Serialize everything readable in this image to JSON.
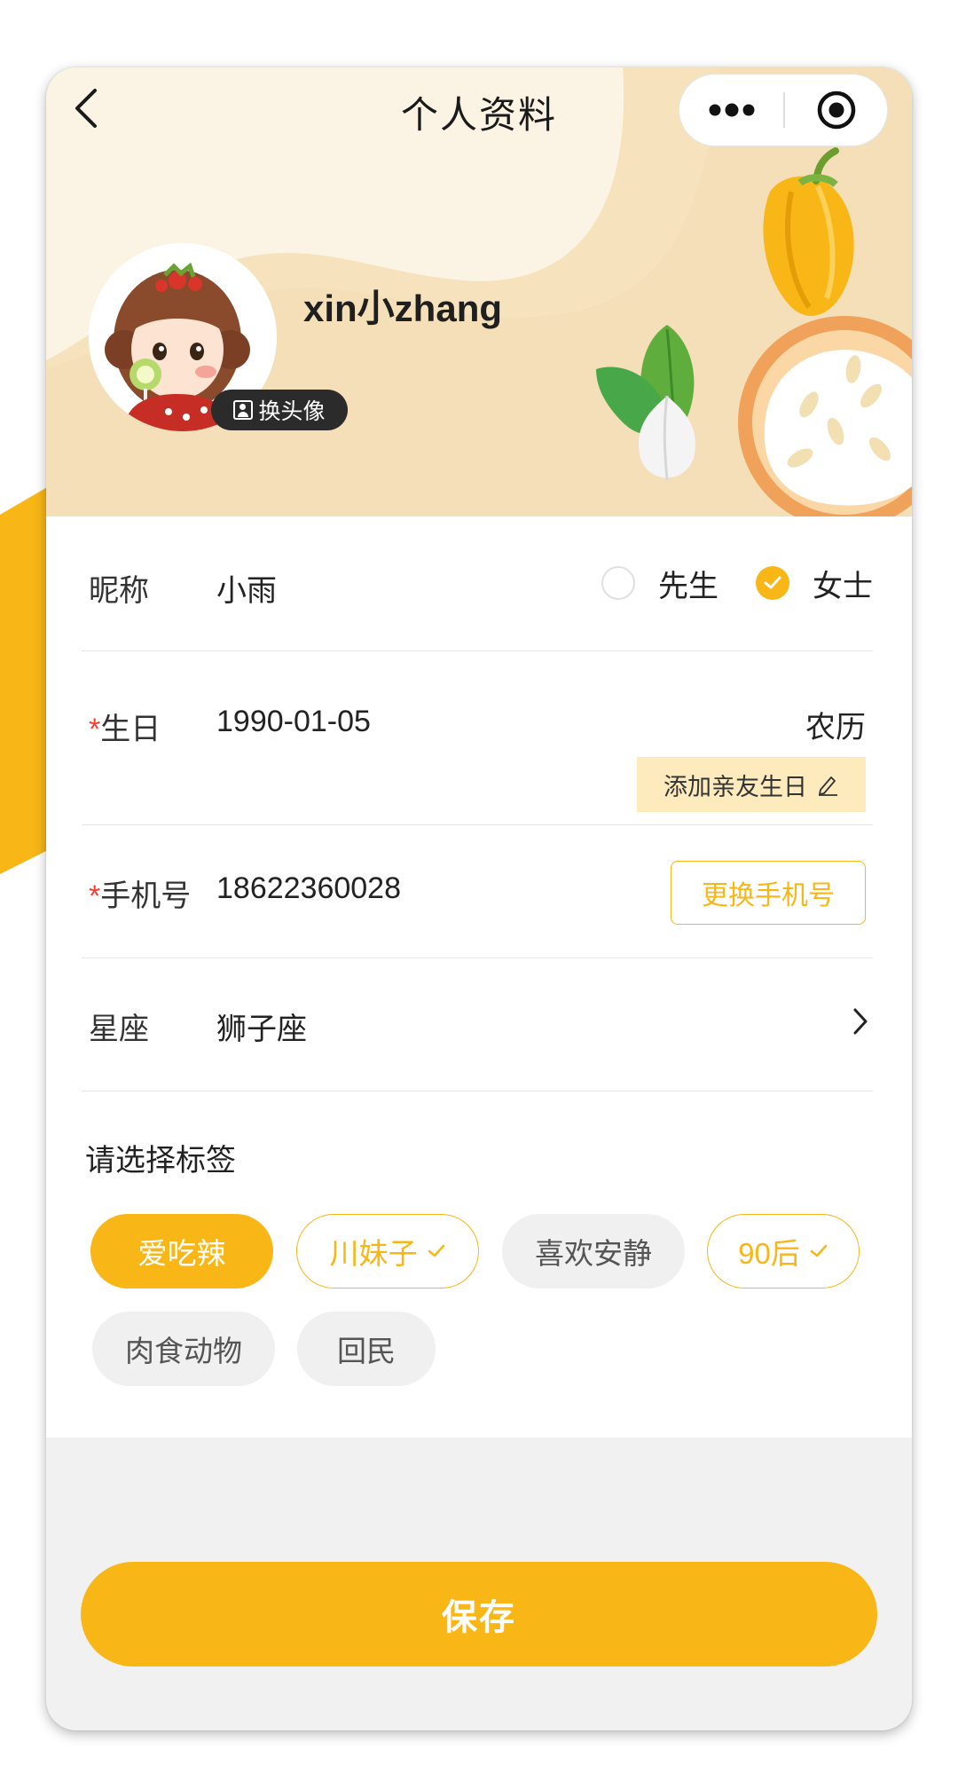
{
  "nav": {
    "title": "个人资料"
  },
  "profile": {
    "username": "xin小zhang",
    "change_avatar_label": "换头像"
  },
  "form": {
    "nickname": {
      "label": "昵称",
      "value": "小雨",
      "gender_options": [
        "先生",
        "女士"
      ],
      "selected_gender": "女士"
    },
    "birthday": {
      "required_mark": "*",
      "label": "生日",
      "value": "1990-01-05",
      "calendar_toggle": "农历",
      "add_friend_label": "添加亲友生日"
    },
    "phone": {
      "required_mark": "*",
      "label": "手机号",
      "value": "18622360028",
      "change_label": "更换手机号"
    },
    "constellation": {
      "label": "星座",
      "value": "狮子座"
    },
    "tags": {
      "title": "请选择标签",
      "items": [
        {
          "label": "爱吃辣",
          "state": "filled"
        },
        {
          "label": "川妹子",
          "state": "checked"
        },
        {
          "label": "喜欢安静",
          "state": "unselected"
        },
        {
          "label": "90后",
          "state": "checked"
        },
        {
          "label": "肉食动物",
          "state": "unselected"
        },
        {
          "label": "回民",
          "state": "unselected"
        }
      ]
    }
  },
  "actions": {
    "save_label": "保存"
  },
  "colors": {
    "accent": "#f8b617",
    "banner_bg": "#fbf3e3",
    "required": "#ff3b30",
    "tag_grey": "#f0f0f0"
  },
  "icons": [
    "back-icon",
    "more-icon",
    "close-capsule-icon",
    "portrait-icon",
    "pencil-icon",
    "check-icon",
    "chevron-right-icon"
  ]
}
